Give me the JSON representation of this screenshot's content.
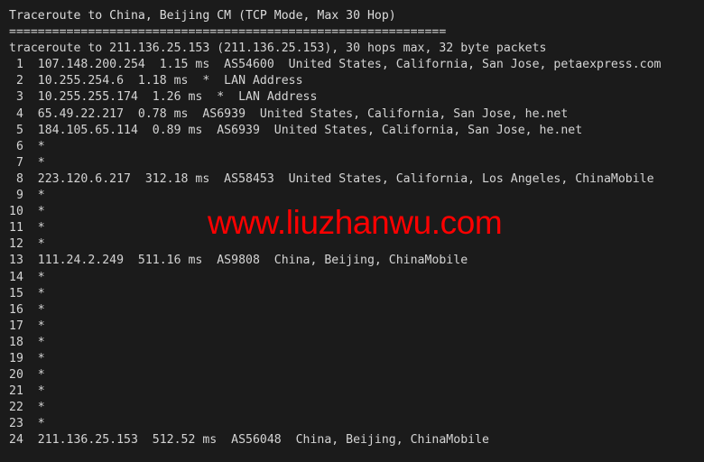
{
  "terminal": {
    "title_line": "Traceroute to China, Beijing CM (TCP Mode, Max 30 Hop)",
    "separator": "=============================================================",
    "header_line": "traceroute to 211.136.25.153 (211.136.25.153), 30 hops max, 32 byte packets",
    "background_color": "#1b1b1b",
    "text_color": "#d4d4d4"
  },
  "watermark": {
    "text": "www.liuzhanwu.com",
    "color": "#fe0000"
  },
  "hops": [
    {
      "num": "1",
      "line": " 1  107.148.200.254  1.15 ms  AS54600  United States, California, San Jose, petaexpress.com"
    },
    {
      "num": "2",
      "line": " 2  10.255.254.6  1.18 ms  *  LAN Address"
    },
    {
      "num": "3",
      "line": " 3  10.255.255.174  1.26 ms  *  LAN Address"
    },
    {
      "num": "4",
      "line": " 4  65.49.22.217  0.78 ms  AS6939  United States, California, San Jose, he.net"
    },
    {
      "num": "5",
      "line": " 5  184.105.65.114  0.89 ms  AS6939  United States, California, San Jose, he.net"
    },
    {
      "num": "6",
      "line": " 6  *"
    },
    {
      "num": "7",
      "line": " 7  *"
    },
    {
      "num": "8",
      "line": " 8  223.120.6.217  312.18 ms  AS58453  United States, California, Los Angeles, ChinaMobile"
    },
    {
      "num": "9",
      "line": " 9  *"
    },
    {
      "num": "10",
      "line": "10  *"
    },
    {
      "num": "11",
      "line": "11  *"
    },
    {
      "num": "12",
      "line": "12  *"
    },
    {
      "num": "13",
      "line": "13  111.24.2.249  511.16 ms  AS9808  China, Beijing, ChinaMobile"
    },
    {
      "num": "14",
      "line": "14  *"
    },
    {
      "num": "15",
      "line": "15  *"
    },
    {
      "num": "16",
      "line": "16  *"
    },
    {
      "num": "17",
      "line": "17  *"
    },
    {
      "num": "18",
      "line": "18  *"
    },
    {
      "num": "19",
      "line": "19  *"
    },
    {
      "num": "20",
      "line": "20  *"
    },
    {
      "num": "21",
      "line": "21  *"
    },
    {
      "num": "22",
      "line": "22  *"
    },
    {
      "num": "23",
      "line": "23  *"
    },
    {
      "num": "24",
      "line": "24  211.136.25.153  512.52 ms  AS56048  China, Beijing, ChinaMobile"
    }
  ]
}
